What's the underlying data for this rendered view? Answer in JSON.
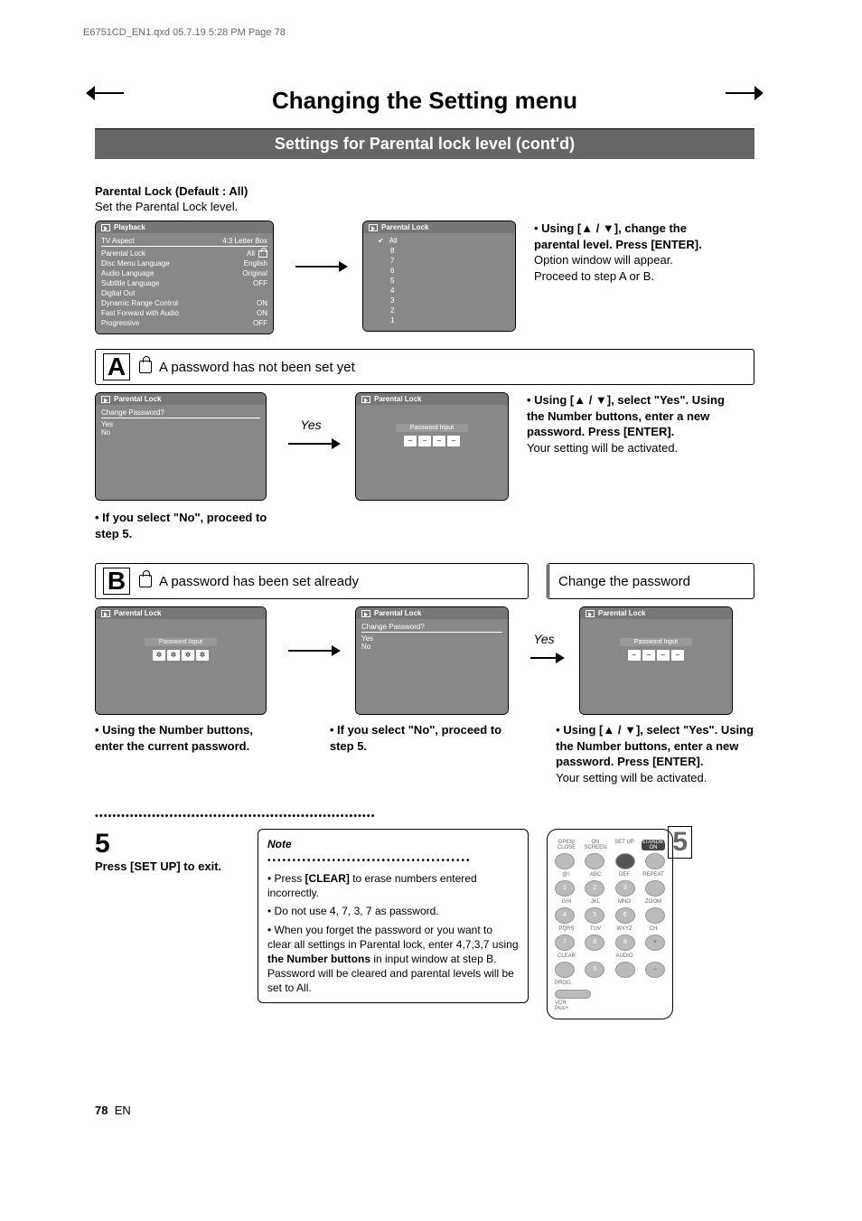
{
  "doc_header": "E6751CD_EN1.qxd  05.7.19  5:28 PM  Page 78",
  "title": "Changing the Setting menu",
  "subtitle": "Settings for Parental lock level (cont'd)",
  "section": {
    "heading": "Parental Lock (Default : All)",
    "sub": "Set the Parental Lock level."
  },
  "settings_panel": {
    "title": "Playback",
    "rows": [
      {
        "label": "TV Aspect",
        "value": "4:3 Letter Box"
      },
      {
        "label": "Parental Lock",
        "value": "All"
      },
      {
        "label": "Disc Menu Language",
        "value": "English"
      },
      {
        "label": "Audio Language",
        "value": "Original"
      },
      {
        "label": "Subtitle Language",
        "value": "OFF"
      },
      {
        "label": "Digital Out",
        "value": ""
      },
      {
        "label": "Dynamic Range Control",
        "value": "ON"
      },
      {
        "label": "Fast Forward with Audio",
        "value": "ON"
      },
      {
        "label": "Progressive",
        "value": "OFF"
      }
    ]
  },
  "level_panel": {
    "title": "Parental Lock",
    "items": [
      "All",
      "8",
      "7",
      "6",
      "5",
      "4",
      "3",
      "2",
      "1"
    ],
    "selected": "All"
  },
  "instr1": {
    "line1": "• Using [▲ / ▼], change the parental level. Press [ENTER].",
    "line2": "Option window will appear.",
    "line3": "Proceed to step A or B."
  },
  "stepA": {
    "letter": "A",
    "text": "A password has not been set yet",
    "panel1": {
      "title": "Parental Lock",
      "r1": "Change Password?",
      "r2": "Yes",
      "r3": "No"
    },
    "arrow_label": "Yes",
    "panel2": {
      "title": "Parental Lock",
      "pwd_label": "Password Input",
      "chars": [
        "–",
        "–",
        "–",
        "–"
      ]
    },
    "instr": {
      "line1": "• Using [▲ / ▼], select \"Yes\". Using the Number buttons, enter a new password. Press [ENTER].",
      "line2": "Your setting will be activated."
    },
    "foot": "• If you select \"No\", proceed to step 5."
  },
  "stepB": {
    "letter": "B",
    "text": "A password has been set already",
    "change_pw": "Change the password",
    "panel1": {
      "title": "Parental Lock",
      "pwd_label": "Password Input",
      "chars": [
        "✲",
        "✲",
        "✲",
        "✲"
      ]
    },
    "panel2": {
      "title": "Parental Lock",
      "r1": "Change Password?",
      "r2": "Yes",
      "r3": "No"
    },
    "arrow_label": "Yes",
    "panel3": {
      "title": "Parental Lock",
      "pwd_label": "Password Input",
      "chars": [
        "–",
        "–",
        "–",
        "–"
      ]
    },
    "cap1": "• Using the Number buttons, enter the current password.",
    "cap2": "• If you select \"No\", proceed to step 5.",
    "cap3a": "• Using [▲ / ▼], select \"Yes\". Using the Number buttons, enter a new password. Press [ENTER].",
    "cap3b": "Your setting will be activated."
  },
  "step5": {
    "number": "5",
    "line": "Press [SET UP] to exit."
  },
  "note": {
    "title": "Note",
    "b1a": "• Press ",
    "b1b": "[CLEAR]",
    "b1c": " to erase numbers entered incorrectly.",
    "b2": "• Do not use 4, 7, 3, 7 as password.",
    "b3a": "• When you forget the password or you want to clear all settings in Parental lock, enter 4,7,3,7 using ",
    "b3b": "the Number buttons",
    "b3c": " in input window at step B. Password will be cleared and parental levels will be set to All."
  },
  "remote": {
    "row1": [
      "OPEN/\nCLOSE",
      "ON SCREEN",
      "SET UP",
      "STANDBY-ON"
    ],
    "row2": [
      "@!.",
      "ABC",
      "DEF",
      "REPEAT"
    ],
    "nums2": [
      "1",
      "2",
      "3",
      ""
    ],
    "row3": [
      "GHI",
      "JKL",
      "MNO",
      "ZOOM"
    ],
    "nums3": [
      "4",
      "5",
      "6",
      ""
    ],
    "row4": [
      "PQRS",
      "TUV",
      "WXYZ",
      "CH"
    ],
    "nums4": [
      "7",
      "8",
      "9",
      "+"
    ],
    "row5": [
      "CLEAR",
      "",
      "AUDIO",
      "–"
    ],
    "nums5": [
      "",
      "0",
      "",
      ""
    ],
    "prog": "PROG.",
    "vcr": "VCR Plus+"
  },
  "footer": {
    "page": "78",
    "lang": "EN"
  }
}
